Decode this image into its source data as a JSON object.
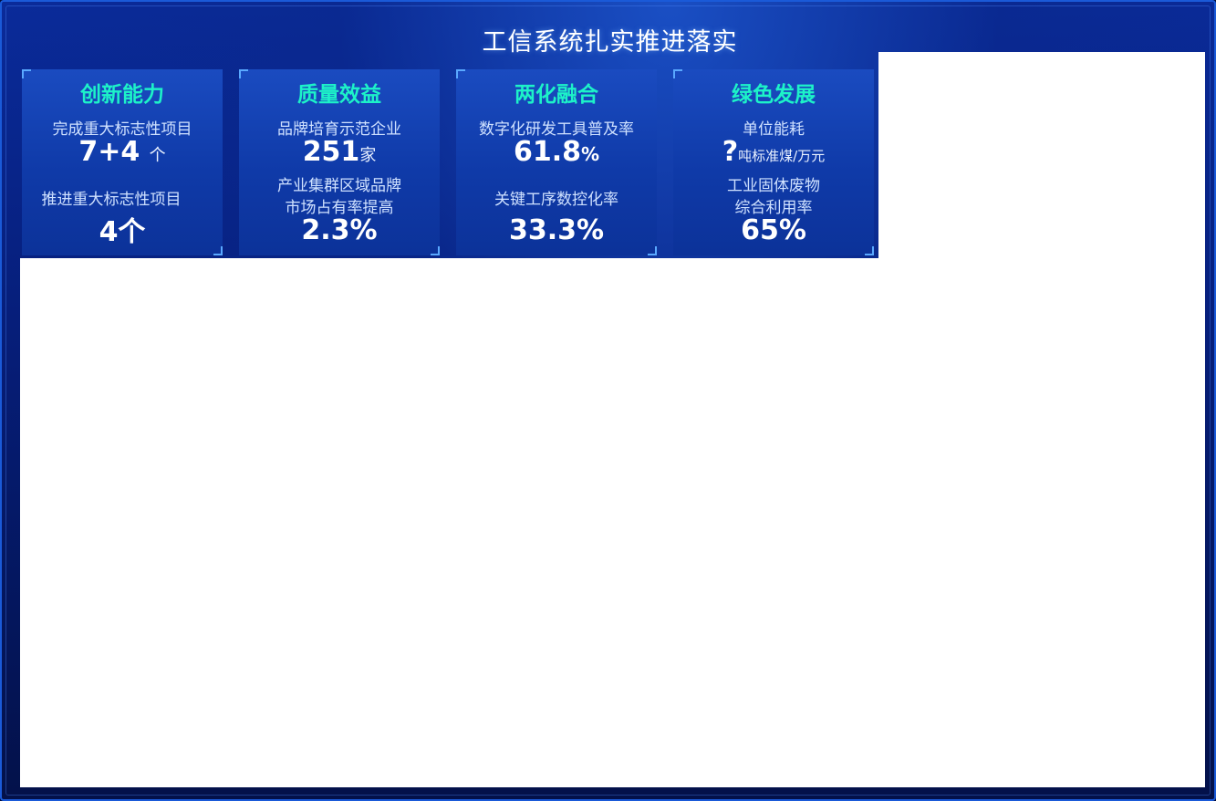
{
  "title": "工信系统扎实推进落实",
  "cards": [
    {
      "title": "创新能力",
      "l1": "完成重大标志性项目",
      "v1": "7+4",
      "u1": "个",
      "l2": "推进重大标志性项目",
      "v2": "4个"
    },
    {
      "title": "质量效益",
      "l1": "品牌培育示范企业",
      "v1": "251",
      "u1": "家",
      "l2a": "产业集群区域品牌",
      "l2b": "市场占有率提高",
      "v2": "2.3%"
    },
    {
      "title": "两化融合",
      "l1": "数字化研发工具普及率",
      "v1": "61.8",
      "u1": "%",
      "l2": "关键工序数控化率",
      "v2": "33.3%"
    },
    {
      "title": "绿色发展",
      "l1": "单位能耗",
      "v1": "?",
      "u1": "吨标准煤/万元",
      "l2a": "工业固体废物",
      "l2b": "综合利用率",
      "v2": "65%"
    }
  ],
  "colors": {
    "card_title": "#1df2c8",
    "label": "#cfe1ff",
    "value": "#ffffff",
    "corner": "#5aa9ff"
  }
}
